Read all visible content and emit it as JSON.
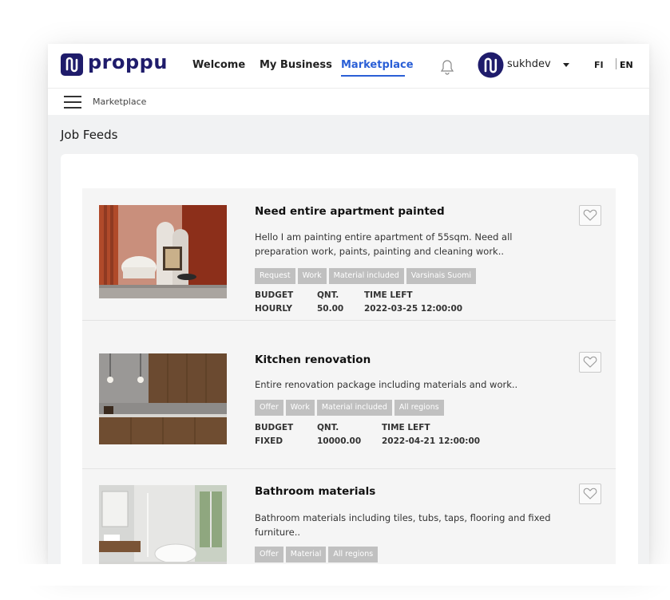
{
  "brand": {
    "name": "proppu"
  },
  "nav": {
    "items": [
      {
        "label": "Welcome"
      },
      {
        "label": "My Business"
      },
      {
        "label": "Marketplace"
      }
    ],
    "active": "Marketplace"
  },
  "user": {
    "name": "sukhdev"
  },
  "lang": {
    "fi": "FI",
    "en": "EN",
    "active": "EN"
  },
  "breadcrumb": {
    "label": "Marketplace"
  },
  "page": {
    "title": "Job Feeds"
  },
  "jobs": [
    {
      "title": "Need entire apartment painted",
      "description": "Hello I am painting entire apartment of 55sqm. Need all preparation work, paints, painting and cleaning work..",
      "tags": [
        "Request",
        "Work",
        "Material included",
        "Varsinais Suomi"
      ],
      "budget_label": "BUDGET",
      "qnt_label": "QNT.",
      "time_label": "TIME LEFT",
      "budget": "HOURLY",
      "qnt": "50.00",
      "time": "2022-03-25 12:00:00"
    },
    {
      "title": "Kitchen renovation",
      "description": "Entire renovation package including materials and work..",
      "tags": [
        "Offer",
        "Work",
        "Material included",
        "All regions"
      ],
      "budget_label": "BUDGET",
      "qnt_label": "QNT.",
      "time_label": "TIME LEFT",
      "budget": "FIXED",
      "qnt": "10000.00",
      "time": "2022-04-21 12:00:00"
    },
    {
      "title": "Bathroom materials",
      "description": "Bathroom materials including tiles, tubs, taps, flooring and fixed furniture..",
      "tags": [
        "Offer",
        "Material",
        "All regions"
      ]
    }
  ],
  "colors": {
    "brand": "#1f1c6b",
    "accent": "#2a5fd6",
    "tag": "#c0c0c0"
  }
}
